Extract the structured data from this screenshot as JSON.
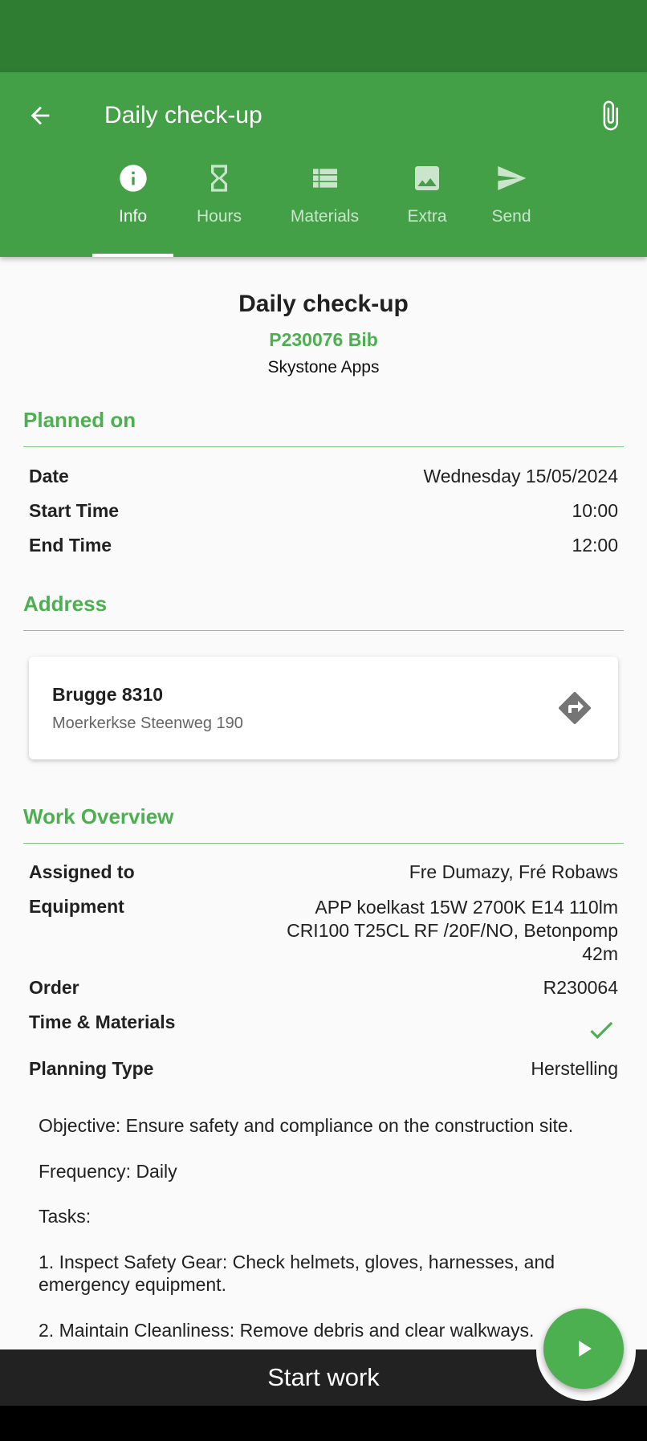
{
  "app_bar": {
    "title": "Daily check-up",
    "back_icon": "arrow-back-icon",
    "attach_icon": "paperclip-icon"
  },
  "tabs": [
    {
      "label": "Info",
      "icon": "info-icon",
      "active": true
    },
    {
      "label": "Hours",
      "icon": "hourglass-icon",
      "active": false
    },
    {
      "label": "Materials",
      "icon": "list-icon",
      "active": false
    },
    {
      "label": "Extra",
      "icon": "image-icon",
      "active": false
    },
    {
      "label": "Send",
      "icon": "send-icon",
      "active": false
    }
  ],
  "header": {
    "title": "Daily check-up",
    "code": "P230076 Bib",
    "company": "Skystone Apps"
  },
  "planned": {
    "section_title": "Planned on",
    "date_label": "Date",
    "date_value": "Wednesday 15/05/2024",
    "start_label": "Start Time",
    "start_value": "10:00",
    "end_label": "End Time",
    "end_value": "12:00"
  },
  "address": {
    "section_title": "Address",
    "city": "Brugge 8310",
    "street": "Moerkerkse Steenweg 190",
    "directions_icon": "directions-icon"
  },
  "work": {
    "section_title": "Work Overview",
    "assigned_label": "Assigned to",
    "assigned_value": "Fre Dumazy, Fré Robaws",
    "equipment_label": "Equipment",
    "equipment_line1": "APP koelkast 15W 2700K E14 110lm",
    "equipment_line2": "CRI100 T25CL RF /20F/NO, Betonpomp",
    "equipment_line3": "42m",
    "order_label": "Order",
    "order_value": "R230064",
    "tm_label": "Time & Materials",
    "tm_checked": true,
    "planning_label": "Planning Type",
    "planning_value": "Herstelling"
  },
  "description": {
    "objective": "Objective: Ensure safety and compliance on the construction site.",
    "frequency": "Frequency: Daily",
    "tasks_label": "Tasks:",
    "task1": "1.    Inspect Safety Gear: Check helmets, gloves, harnesses, and emergency equipment.",
    "task2": "2.    Maintain Cleanliness: Remove debris and clear walkways."
  },
  "bottom": {
    "start_label": "Start work",
    "play_icon": "play-icon"
  },
  "colors": {
    "status_bar": "#2e7d32",
    "app_bar": "#43a047",
    "accent": "#4caf50",
    "bottom_bar": "#222222"
  }
}
